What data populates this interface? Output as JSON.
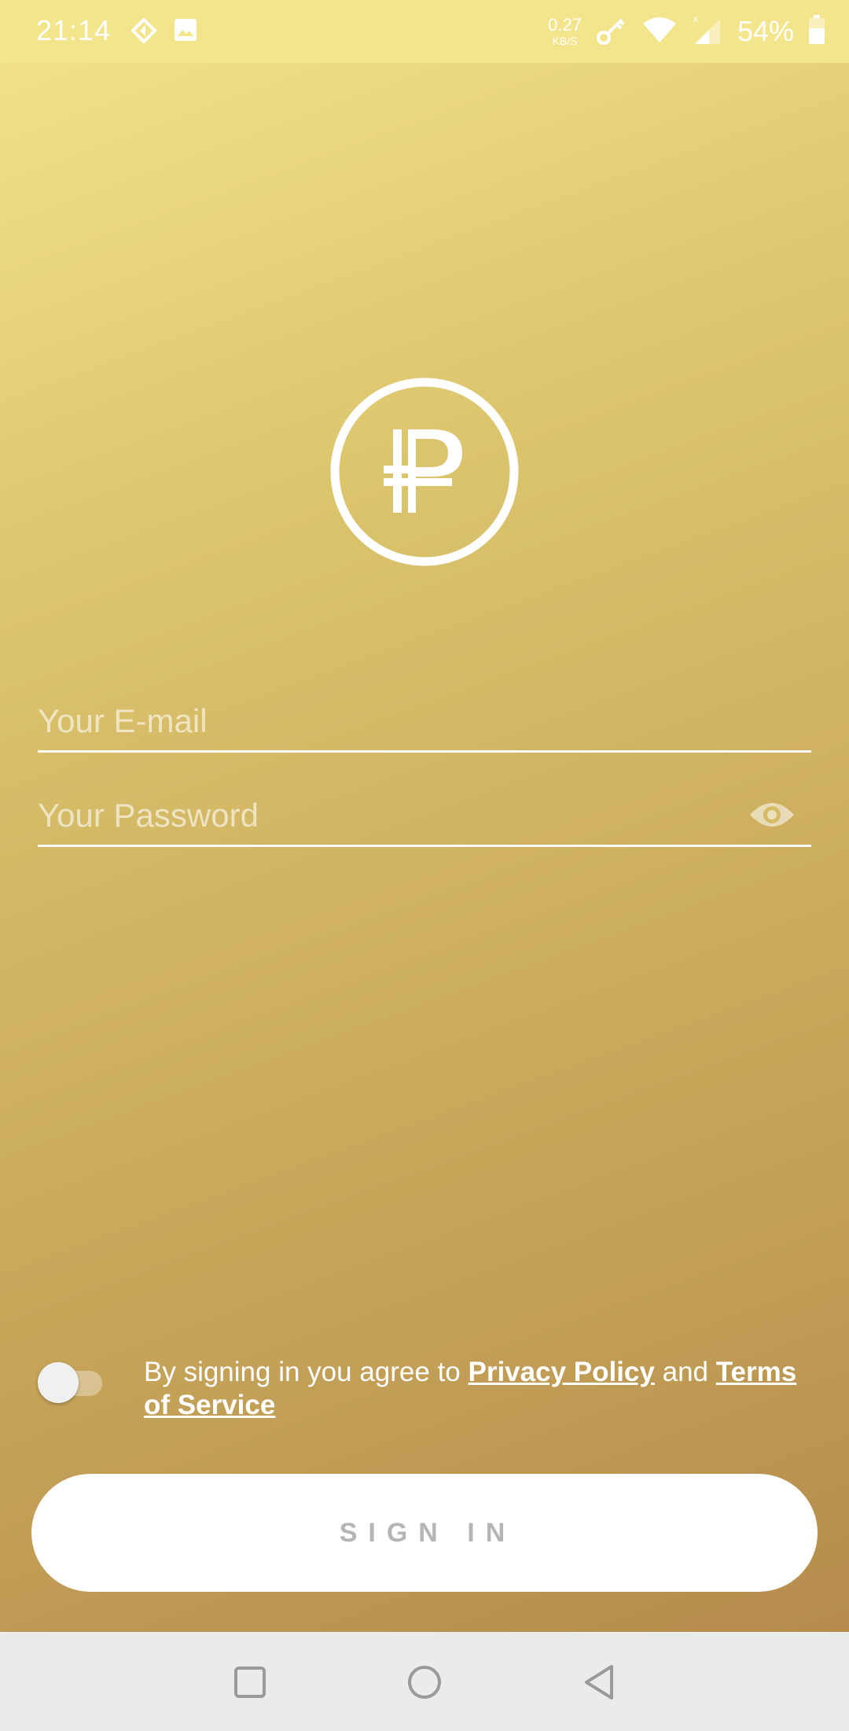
{
  "status_bar": {
    "time": "21:14",
    "left_icons": [
      "navigation-app-icon",
      "image-icon"
    ],
    "net_speed_value": "0.27",
    "net_speed_unit": "KB/S",
    "right_icons": [
      "vpn-key-icon",
      "wifi-icon",
      "signal-icon",
      "battery-icon"
    ],
    "battery_percent": "54%"
  },
  "login": {
    "logo": "ruble-logo-icon",
    "email_placeholder": "Your E-mail",
    "email_value": "",
    "password_placeholder": "Your Password",
    "password_value": "",
    "password_visibility_icon": "eye-icon",
    "agree_toggle_on": false,
    "consent_prefix": "By signing in you agree to ",
    "privacy_link": "Privacy Policy",
    "consent_and": " and ",
    "terms_link": "Terms of Service",
    "sign_in_label": "SIGN IN"
  },
  "nav_bar": {
    "recents_icon": "square-recents-icon",
    "home_icon": "circle-home-icon",
    "back_icon": "triangle-back-icon"
  },
  "colors": {
    "gradient_top": "#f3e58a",
    "gradient_bottom": "#b3884a",
    "status_bar_bg": "#f2e58b",
    "button_bg": "#ffffff",
    "button_text": "#b5b5b5",
    "nav_bar_bg": "#ebebeb"
  }
}
